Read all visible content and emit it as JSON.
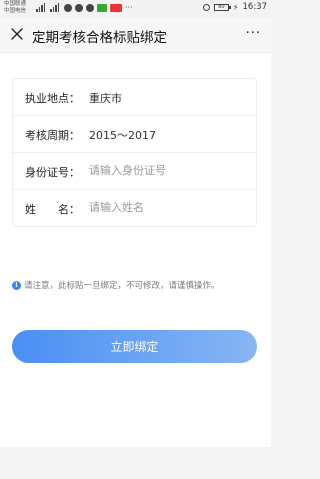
{
  "status_bar": {
    "carrier_top": "中国联通",
    "carrier_bottom": "中国电信",
    "battery_level": "80",
    "time": "16:37"
  },
  "nav": {
    "title": "定期考核合格标贴绑定",
    "more": "···"
  },
  "form": {
    "location": {
      "label": "执业地点：",
      "value": "重庆市"
    },
    "period": {
      "label": "考核周期：",
      "value": "2015～2017"
    },
    "id_number": {
      "label": "身份证号：",
      "placeholder": "请输入身份证号"
    },
    "name": {
      "label": "姓　　名：",
      "placeholder": "请输入姓名"
    }
  },
  "notice": {
    "text": "请注意，此标贴一旦绑定，不可修改，请谨慎操作。"
  },
  "actions": {
    "bind_label": "立即绑定"
  },
  "colors": {
    "accent": "#4a8ff5",
    "accent_light": "#87b6f3",
    "notice_icon": "#3b82f6"
  }
}
